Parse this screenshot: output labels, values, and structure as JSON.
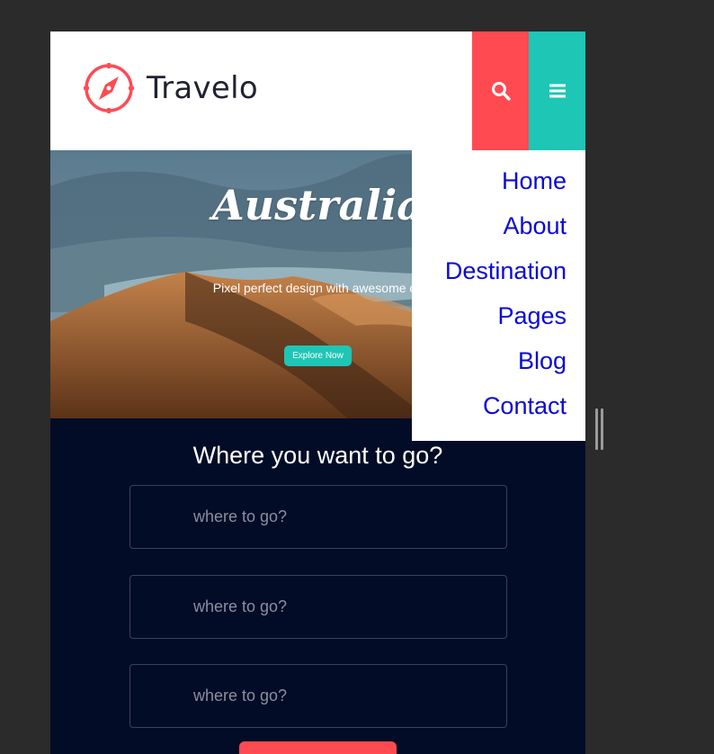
{
  "header": {
    "brand_name": "Travelo",
    "logo_icon": "compass-icon",
    "search_icon": "search-icon",
    "menu_icon": "hamburger-menu-icon",
    "colors": {
      "search_button": "#ff4a52",
      "menu_button": "#1ec6b6"
    }
  },
  "nav_menu": {
    "items": [
      {
        "label": "Home"
      },
      {
        "label": "About"
      },
      {
        "label": "Destination"
      },
      {
        "label": "Pages"
      },
      {
        "label": "Blog"
      },
      {
        "label": "Contact"
      }
    ],
    "link_color": "#0a0ad6"
  },
  "hero": {
    "title": "Australia",
    "subtitle": "Pixel perfect design with awesome co",
    "cta_label": "Explore Now",
    "cta_color": "#1ec6b6"
  },
  "search": {
    "heading": "Where you want to go?",
    "fields": [
      {
        "placeholder": "where to go?"
      },
      {
        "placeholder": "where to go?"
      },
      {
        "placeholder": "where to go?"
      }
    ],
    "background": "#020c26",
    "submit_color": "#ff4a52"
  }
}
